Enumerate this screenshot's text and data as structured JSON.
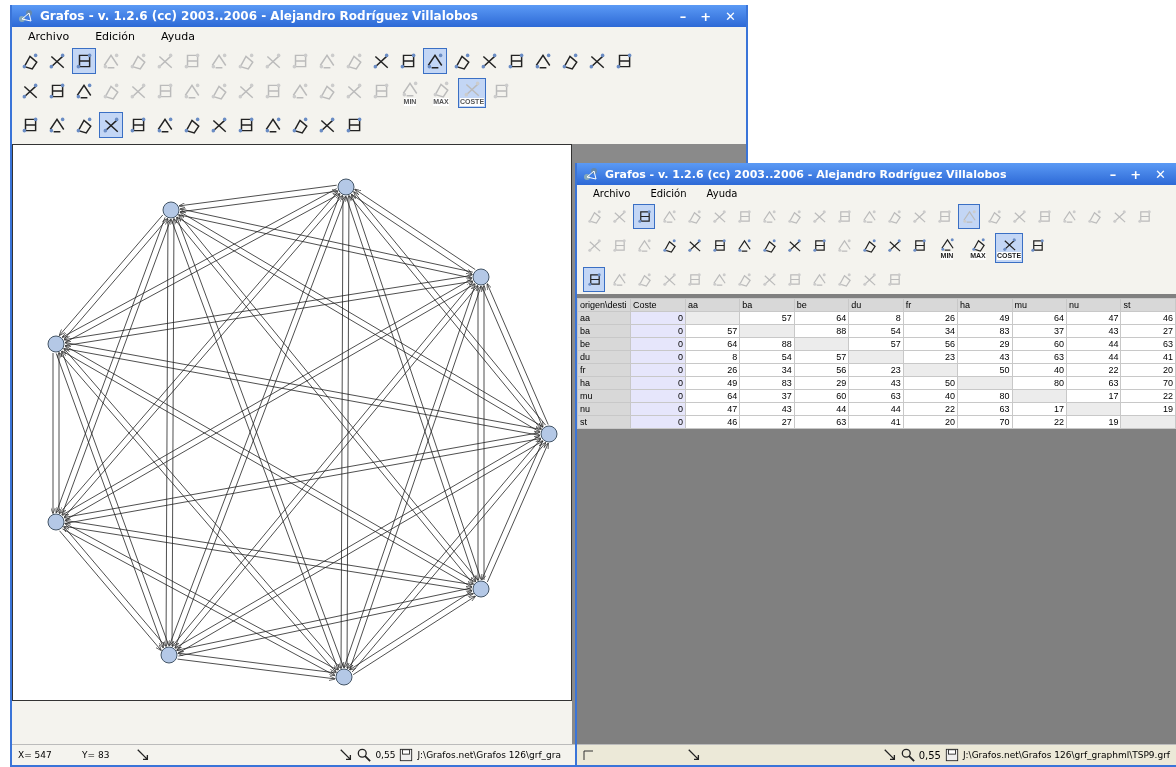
{
  "left_window": {
    "title": "Grafos - v. 1.2.6  (cc) 2003..2006 - Alejandro Rodríguez Villalobos",
    "controls": [
      "–",
      "+",
      "✕"
    ],
    "menu": [
      "Archivo",
      "Edición",
      "Ayuda"
    ],
    "toolbars": [
      [
        {
          "selected": false,
          "disabled": false
        },
        {
          "selected": false,
          "disabled": false
        },
        {
          "selected": true,
          "disabled": false
        },
        {
          "selected": false,
          "disabled": true
        },
        {
          "selected": false,
          "disabled": true
        },
        {
          "selected": false,
          "disabled": true
        },
        {
          "selected": false,
          "disabled": true
        },
        {
          "selected": false,
          "disabled": true
        },
        {
          "selected": false,
          "disabled": true
        },
        {
          "selected": false,
          "disabled": true
        },
        {
          "selected": false,
          "disabled": true
        },
        {
          "selected": false,
          "disabled": true
        },
        {
          "selected": false,
          "disabled": true
        },
        {
          "selected": false,
          "disabled": false
        },
        {
          "selected": false,
          "disabled": false
        },
        {
          "selected": true,
          "disabled": false
        },
        {
          "selected": false,
          "disabled": false
        },
        {
          "selected": false,
          "disabled": false
        },
        {
          "selected": false,
          "disabled": false
        },
        {
          "selected": false,
          "disabled": false
        },
        {
          "selected": false,
          "disabled": false
        },
        {
          "selected": false,
          "disabled": false
        },
        {
          "selected": false,
          "disabled": false
        }
      ],
      [
        {
          "selected": false,
          "disabled": false
        },
        {
          "selected": false,
          "disabled": false
        },
        {
          "selected": false,
          "disabled": false
        },
        {
          "selected": false,
          "disabled": true
        },
        {
          "selected": false,
          "disabled": true
        },
        {
          "selected": false,
          "disabled": true
        },
        {
          "selected": false,
          "disabled": true
        },
        {
          "selected": false,
          "disabled": true
        },
        {
          "selected": false,
          "disabled": true
        },
        {
          "selected": false,
          "disabled": true
        },
        {
          "selected": false,
          "disabled": true
        },
        {
          "selected": false,
          "disabled": true
        },
        {
          "selected": false,
          "disabled": true
        },
        {
          "selected": false,
          "disabled": true
        },
        {
          "selected": false,
          "disabled": true,
          "caption": "MIN"
        },
        {
          "selected": false,
          "disabled": true,
          "caption": "MAX"
        },
        {
          "selected": true,
          "disabled": true,
          "caption": "COSTE"
        },
        {
          "selected": false,
          "disabled": true
        }
      ],
      [
        {
          "selected": false,
          "disabled": false
        },
        {
          "selected": false,
          "disabled": false
        },
        {
          "selected": false,
          "disabled": false
        },
        {
          "selected": true,
          "disabled": false
        },
        {
          "selected": false,
          "disabled": false
        },
        {
          "selected": false,
          "disabled": false
        },
        {
          "selected": false,
          "disabled": false
        },
        {
          "selected": false,
          "disabled": false
        },
        {
          "selected": false,
          "disabled": false
        },
        {
          "selected": false,
          "disabled": false
        },
        {
          "selected": false,
          "disabled": false
        },
        {
          "selected": false,
          "disabled": false
        },
        {
          "selected": false,
          "disabled": false
        }
      ]
    ],
    "status": {
      "x": "X= 547",
      "y": "Y= 83",
      "zoom": "0,55",
      "path": "J:\\Grafos.net\\Grafos 126\\grf_gra"
    }
  },
  "right_window": {
    "title": "Grafos - v. 1.2.6  (cc) 2003..2006 - Alejandro Rodríguez Villalobos",
    "controls": [
      "–",
      "+",
      "✕"
    ],
    "menu": [
      "Archivo",
      "Edición",
      "Ayuda"
    ],
    "toolbars": [
      [
        {
          "selected": false,
          "disabled": true
        },
        {
          "selected": false,
          "disabled": true
        },
        {
          "selected": true,
          "disabled": false
        },
        {
          "selected": false,
          "disabled": true
        },
        {
          "selected": false,
          "disabled": true
        },
        {
          "selected": false,
          "disabled": true
        },
        {
          "selected": false,
          "disabled": true
        },
        {
          "selected": false,
          "disabled": true
        },
        {
          "selected": false,
          "disabled": true
        },
        {
          "selected": false,
          "disabled": true
        },
        {
          "selected": false,
          "disabled": true
        },
        {
          "selected": false,
          "disabled": true
        },
        {
          "selected": false,
          "disabled": true
        },
        {
          "selected": false,
          "disabled": true
        },
        {
          "selected": false,
          "disabled": true
        },
        {
          "selected": true,
          "disabled": true
        },
        {
          "selected": false,
          "disabled": true
        },
        {
          "selected": false,
          "disabled": true
        },
        {
          "selected": false,
          "disabled": true
        },
        {
          "selected": false,
          "disabled": true
        },
        {
          "selected": false,
          "disabled": true
        },
        {
          "selected": false,
          "disabled": true
        },
        {
          "selected": false,
          "disabled": true
        }
      ],
      [
        {
          "selected": false,
          "disabled": true
        },
        {
          "selected": false,
          "disabled": true
        },
        {
          "selected": false,
          "disabled": true
        },
        {
          "selected": false,
          "disabled": false
        },
        {
          "selected": false,
          "disabled": false
        },
        {
          "selected": false,
          "disabled": false
        },
        {
          "selected": false,
          "disabled": false
        },
        {
          "selected": false,
          "disabled": false
        },
        {
          "selected": false,
          "disabled": false
        },
        {
          "selected": false,
          "disabled": false
        },
        {
          "selected": false,
          "disabled": true
        },
        {
          "selected": false,
          "disabled": false
        },
        {
          "selected": false,
          "disabled": false
        },
        {
          "selected": false,
          "disabled": false
        },
        {
          "selected": false,
          "disabled": false,
          "caption": "MIN"
        },
        {
          "selected": false,
          "disabled": false,
          "caption": "MAX"
        },
        {
          "selected": true,
          "disabled": false,
          "caption": "COSTE"
        },
        {
          "selected": false,
          "disabled": false
        }
      ],
      [
        {
          "selected": true,
          "disabled": false
        },
        {
          "selected": false,
          "disabled": true
        },
        {
          "selected": false,
          "disabled": true
        },
        {
          "selected": false,
          "disabled": true
        },
        {
          "selected": false,
          "disabled": true
        },
        {
          "selected": false,
          "disabled": true
        },
        {
          "selected": false,
          "disabled": true
        },
        {
          "selected": false,
          "disabled": true
        },
        {
          "selected": false,
          "disabled": true
        },
        {
          "selected": false,
          "disabled": true
        },
        {
          "selected": false,
          "disabled": true
        },
        {
          "selected": false,
          "disabled": true
        },
        {
          "selected": false,
          "disabled": true
        }
      ]
    ],
    "table": {
      "columns": [
        "origen\\desti",
        "Coste",
        "aa",
        "ba",
        "be",
        "du",
        "fr",
        "ha",
        "mu",
        "nu",
        "st"
      ],
      "rows": [
        {
          "cells": [
            "aa",
            "0",
            null,
            "57",
            "64",
            "8",
            "26",
            "49",
            "64",
            "47",
            "46"
          ]
        },
        {
          "cells": [
            "ba",
            "0",
            "57",
            null,
            "88",
            "54",
            "34",
            "83",
            "37",
            "43",
            "27"
          ]
        },
        {
          "cells": [
            "be",
            "0",
            "64",
            "88",
            null,
            "57",
            "56",
            "29",
            "60",
            "44",
            "63"
          ]
        },
        {
          "cells": [
            "du",
            "0",
            "8",
            "54",
            "57",
            null,
            "23",
            "43",
            "63",
            "44",
            "41"
          ]
        },
        {
          "cells": [
            "fr",
            "0",
            "26",
            "34",
            "56",
            "23",
            null,
            "50",
            "40",
            "22",
            "20"
          ]
        },
        {
          "cells": [
            "ha",
            "0",
            "49",
            "83",
            "29",
            "43",
            "50",
            null,
            "80",
            "63",
            "70"
          ]
        },
        {
          "cells": [
            "mu",
            "0",
            "64",
            "37",
            "60",
            "63",
            "40",
            "80",
            null,
            "17",
            "22"
          ]
        },
        {
          "cells": [
            "nu",
            "0",
            "47",
            "43",
            "44",
            "44",
            "22",
            "63",
            "17",
            null,
            "19"
          ]
        },
        {
          "cells": [
            "st",
            "0",
            "46",
            "27",
            "63",
            "41",
            "20",
            "70",
            "22",
            "19",
            null
          ]
        }
      ]
    },
    "status": {
      "zoom": "0,55",
      "path": "J:\\Grafos.net\\Grafos 126\\grf_graphml\\TSP9.grf"
    }
  }
}
